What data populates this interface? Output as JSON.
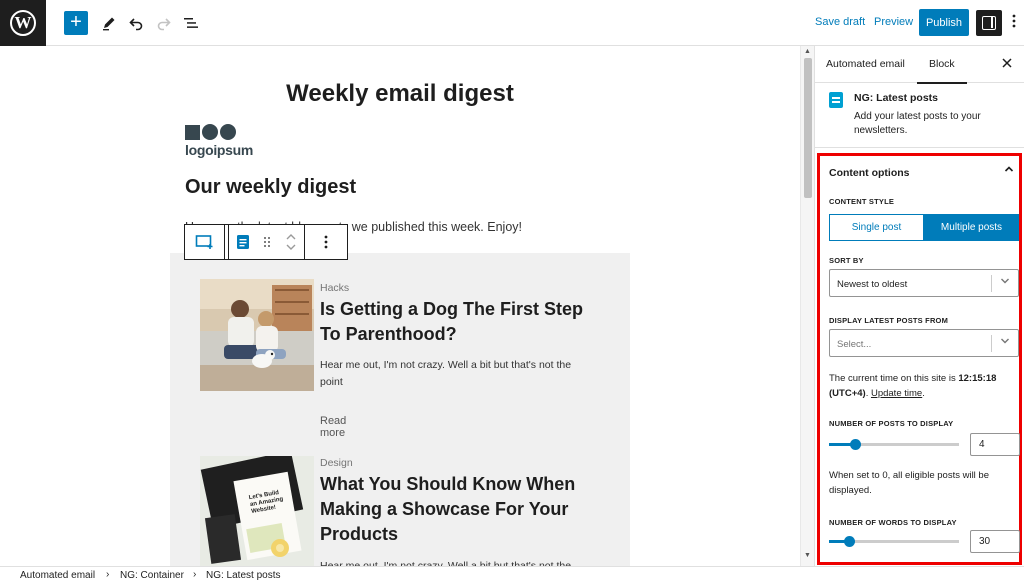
{
  "toolbar": {
    "logo_letter": "W",
    "add_icon": "+",
    "save_draft": "Save draft",
    "preview": "Preview",
    "publish": "Publish"
  },
  "canvas": {
    "email_title": "Weekly email digest",
    "logo_text": "logoipsum",
    "heading": "Our weekly digest",
    "intro": "Here are the latest blog posts we published this week. Enjoy!",
    "posts": [
      {
        "category": "Hacks",
        "title": "Is Getting a Dog The First Step To Parenthood?",
        "excerpt": "Hear me out, I'm not crazy. Well a bit but that's not the point",
        "read_more": "Read more"
      },
      {
        "category": "Design",
        "title": "What You Should Know When Making a Showcase For Your Products",
        "excerpt": "Hear me out, I'm not crazy. Well a bit but that's not the",
        "image_text": "Let's Build an Amazing Website!"
      }
    ]
  },
  "sidebar": {
    "tabs": [
      "Automated email",
      "Block"
    ],
    "active_tab": "Block",
    "block_title": "NG: Latest posts",
    "block_desc": "Add your latest posts to your newsletters.",
    "panel_title": "Content options",
    "content_style_label": "CONTENT STYLE",
    "content_style_options": [
      "Single post",
      "Multiple posts"
    ],
    "content_style_selected": "Multiple posts",
    "sort_by_label": "SORT BY",
    "sort_by_value": "Newest to oldest",
    "display_from_label": "DISPLAY LATEST POSTS FROM",
    "display_from_placeholder": "Select...",
    "time_prefix": "The current time on this site is ",
    "time_value": "12:15:18 (UTC+4)",
    "update_time": "Update time",
    "num_posts_label": "NUMBER OF POSTS TO DISPLAY",
    "num_posts_value": "4",
    "num_posts_help": "When set to 0, all eligible posts will be displayed.",
    "num_words_label": "NUMBER OF WORDS TO DISPLAY",
    "num_words_value": "30",
    "accent_color": "#007cba",
    "highlight_color": "#ee0000"
  },
  "breadcrumb": [
    "Automated email",
    "NG: Container",
    "NG: Latest posts"
  ]
}
